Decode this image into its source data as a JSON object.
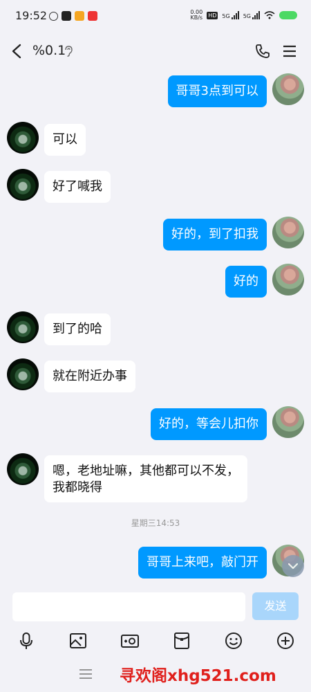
{
  "status": {
    "time": "19:52",
    "net_speed_value": "0.00",
    "net_speed_unit": "KB/s",
    "hd_label": "HD",
    "sig1_label": "5G",
    "sig2_label": "5G",
    "battery_color": "#4cd964"
  },
  "header": {
    "title": "%0.1"
  },
  "messages": [
    {
      "side": "right",
      "text": "哥哥3点到可以"
    },
    {
      "side": "left",
      "text": "可以"
    },
    {
      "side": "left",
      "text": "好了喊我"
    },
    {
      "side": "right",
      "text": "好的，到了扣我"
    },
    {
      "side": "right",
      "text": "好的"
    },
    {
      "side": "left",
      "text": "到了的哈"
    },
    {
      "side": "left",
      "text": "就在附近办事"
    },
    {
      "side": "right",
      "text": "好的，等会儿扣你"
    },
    {
      "side": "left",
      "text_line1": "嗯，老地址嘛，其他都可以不发，",
      "text_line2": "我都晓得"
    },
    {
      "side": "right",
      "text": "哥哥上来吧，敲门开"
    }
  ],
  "timestamp": "星期三14:53",
  "input": {
    "value": "",
    "send_label": "发送"
  },
  "toolbar_icons": [
    "microphone-icon",
    "image-icon",
    "camera-icon",
    "red-packet-icon",
    "emoji-icon",
    "plus-icon"
  ],
  "watermark": "寻欢阁xhg521.com",
  "colors": {
    "accent": "#0099ff",
    "send_disabled": "#a9d6fb",
    "background": "#f2f2f7",
    "watermark": "#e0201c"
  }
}
